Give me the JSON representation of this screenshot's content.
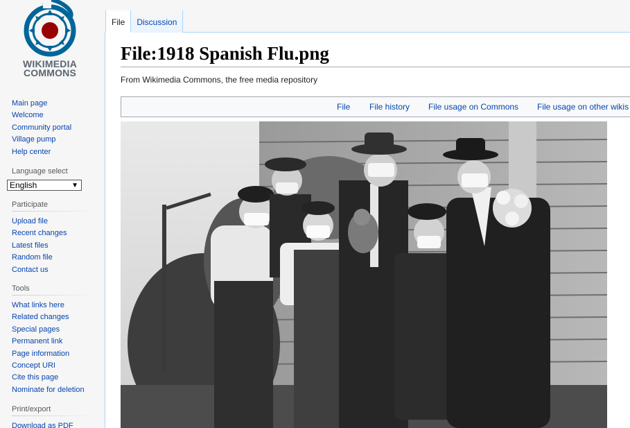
{
  "logo": {
    "line1": "WIKIMEDIA",
    "line2": "COMMONS"
  },
  "nav": {
    "main": [
      "Main page",
      "Welcome",
      "Community portal",
      "Village pump",
      "Help center"
    ],
    "language": {
      "heading": "Language select",
      "selected": "English"
    },
    "participate": {
      "heading": "Participate",
      "items": [
        "Upload file",
        "Recent changes",
        "Latest files",
        "Random file",
        "Contact us"
      ]
    },
    "tools": {
      "heading": "Tools",
      "items": [
        "What links here",
        "Related changes",
        "Special pages",
        "Permanent link",
        "Page information",
        "Concept URI",
        "Cite this page",
        "Nominate for deletion"
      ]
    },
    "print": {
      "heading": "Print/export",
      "items": [
        "Download as PDF"
      ]
    }
  },
  "tabs": [
    "File",
    "Discussion"
  ],
  "page": {
    "title": "File:1918 Spanish Flu.png",
    "subtitle": "From Wikimedia Commons, the free media repository"
  },
  "file_toc": [
    "File",
    "File history",
    "File usage on Commons",
    "File usage on other wikis"
  ]
}
